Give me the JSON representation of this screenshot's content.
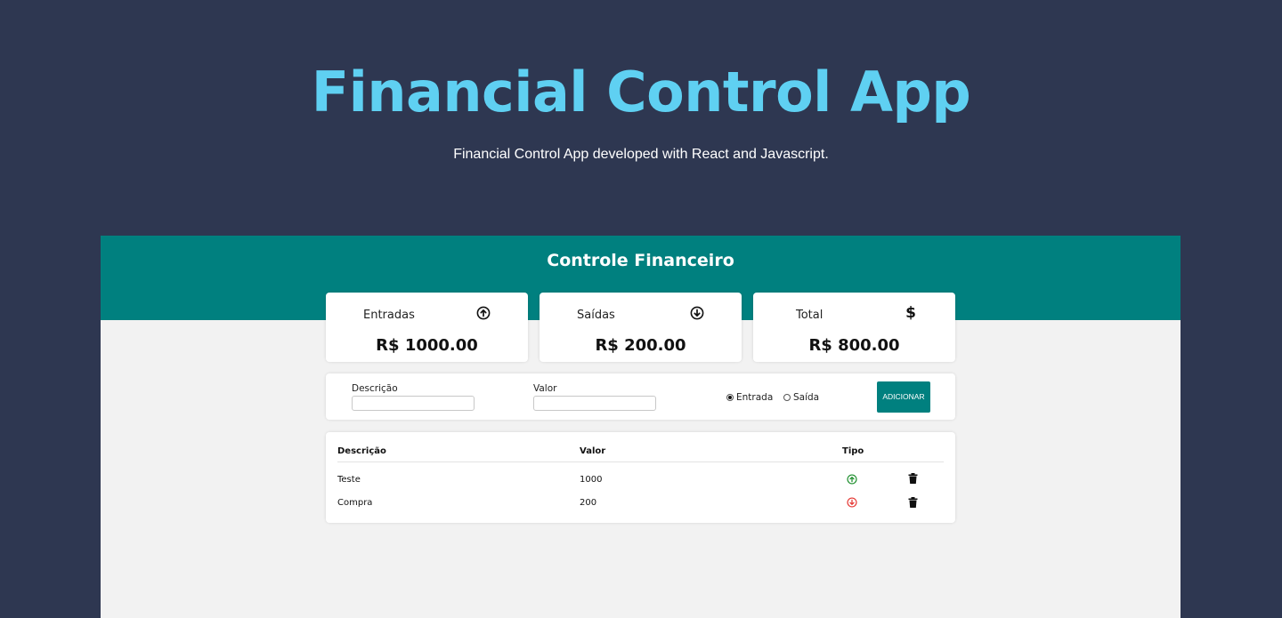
{
  "hero": {
    "title": "Financial Control App",
    "subtitle": "Financial Control App developed with React and Javascript."
  },
  "app": {
    "title": "Controle Financeiro",
    "accent_color": "#00807f"
  },
  "summary": [
    {
      "label": "Entradas",
      "icon": "arrow-circle-up-icon",
      "value": "R$ 1000.00"
    },
    {
      "label": "Saídas",
      "icon": "arrow-circle-down-icon",
      "value": "R$ 200.00"
    },
    {
      "label": "Total",
      "icon": "dollar-sign-icon",
      "value": "R$ 800.00"
    }
  ],
  "form": {
    "description_label": "Descrição",
    "description_value": "",
    "amount_label": "Valor",
    "amount_value": "",
    "radio_income_label": "Entrada",
    "radio_expense_label": "Saída",
    "selected_type": "Entrada",
    "add_button_label": "ADICIONAR"
  },
  "table": {
    "headers": [
      "Descrição",
      "Valor",
      "Tipo"
    ],
    "rows": [
      {
        "description": "Teste",
        "amount": "1000",
        "type": "income",
        "type_icon": "arrow-circle-up-icon",
        "type_color": "#1f8f2e"
      },
      {
        "description": "Compra",
        "amount": "200",
        "type": "expense",
        "type_icon": "arrow-circle-down-icon",
        "type_color": "#e53935"
      }
    ]
  }
}
